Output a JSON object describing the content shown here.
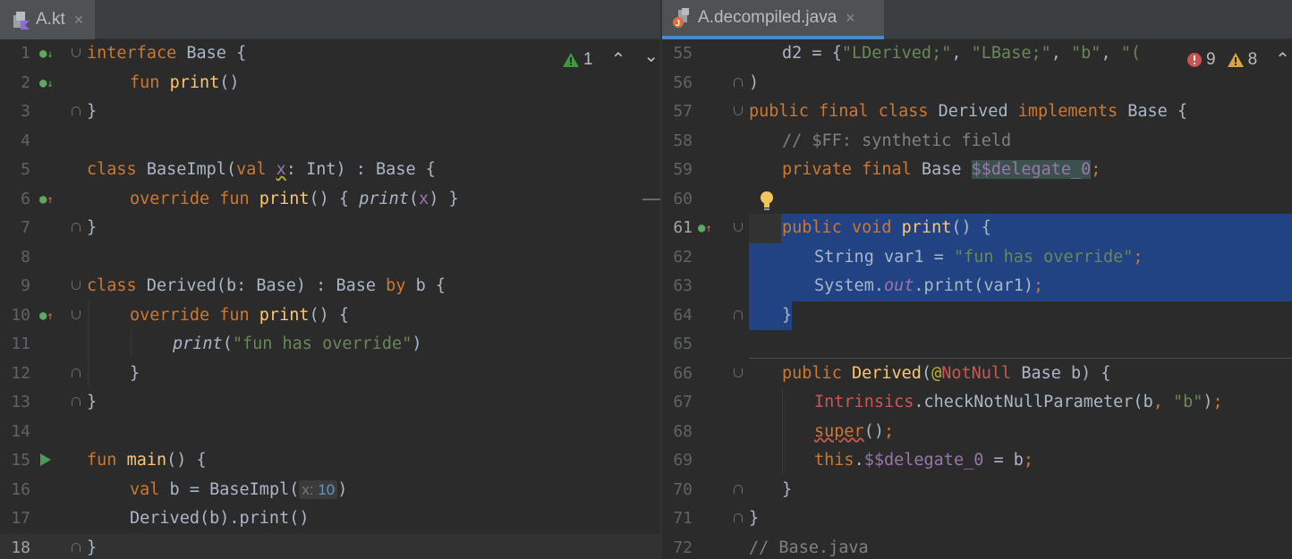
{
  "left": {
    "tab": {
      "label": "A.kt",
      "close": "×"
    },
    "inspection": {
      "warnings": "1",
      "up": "⌃",
      "down": "⌄"
    },
    "lines": [
      "1",
      "2",
      "3",
      "4",
      "5",
      "6",
      "7",
      "8",
      "9",
      "10",
      "11",
      "12",
      "13",
      "14",
      "15",
      "16",
      "17",
      "18"
    ],
    "hint": {
      "label": "x:",
      "value": "10"
    }
  },
  "right": {
    "tab": {
      "label": "A.decompiled.java",
      "close": "×"
    },
    "inspection": {
      "errors": "9",
      "warnings": "8"
    },
    "lines": [
      "55",
      "56",
      "57",
      "58",
      "59",
      "60",
      "61",
      "62",
      "63",
      "64",
      "65",
      "66",
      "67",
      "68",
      "69",
      "70",
      "71",
      "72"
    ]
  },
  "colors": {
    "background": "#2b2b2b",
    "keyword": "#cc7832",
    "function": "#ffc66d",
    "string": "#6a8759",
    "number": "#6897bb",
    "field": "#9876aa",
    "selection": "#214283"
  }
}
